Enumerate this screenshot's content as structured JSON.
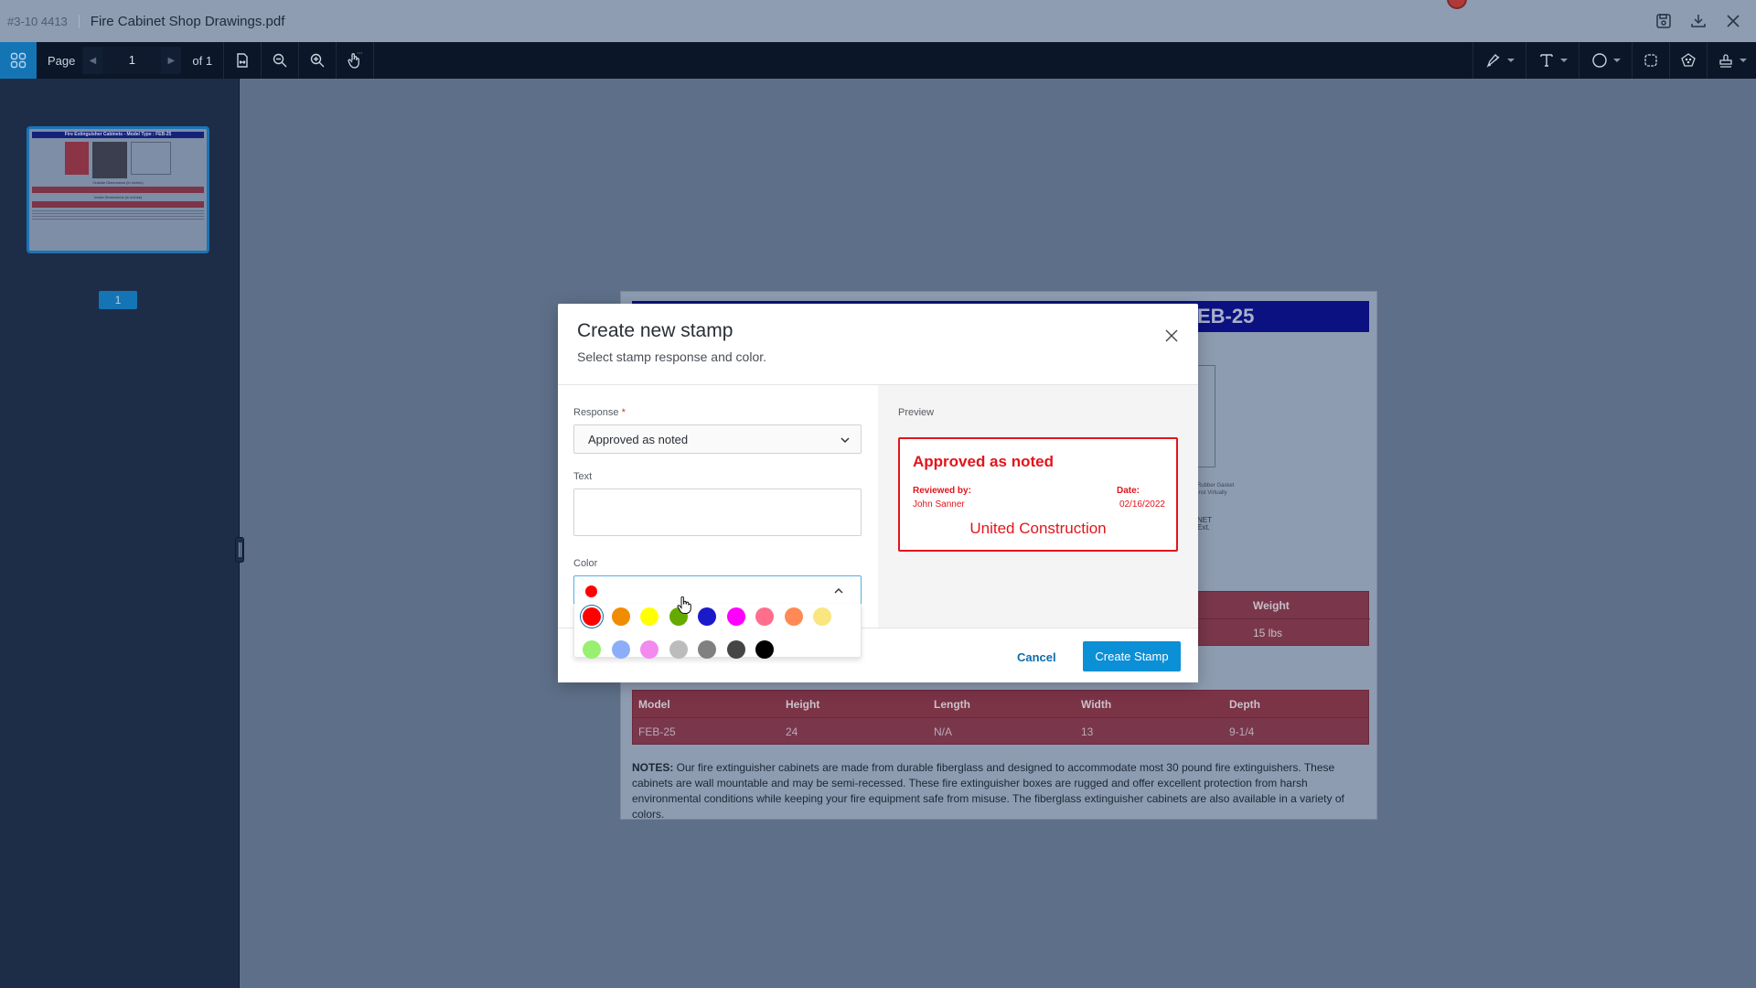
{
  "titlebar": {
    "doc_id": "#3-10 4413",
    "doc_name": "Fire Cabinet Shop Drawings.pdf",
    "icons": [
      "save-icon",
      "download-icon",
      "close-icon"
    ]
  },
  "toolbar": {
    "page_label": "Page",
    "page_value": "1",
    "page_of": "of 1",
    "left_tools": [
      "fit-width-icon",
      "zoom-out-icon",
      "zoom-in-icon",
      "pan-hand-icon"
    ],
    "right_tools": [
      "pen-icon",
      "text-icon",
      "ellipse-icon",
      "cloud-icon",
      "polygon-icon",
      "stamp-icon"
    ]
  },
  "sidebar": {
    "thumbnail_title": "Fire Extinguisher Cabinets - Model Type : FEB-25",
    "thumbnail_sub1": "Outside Dimensions (in inches)",
    "thumbnail_sub2": "Inside Dimensions (in inches)",
    "page_badge": "1"
  },
  "document": {
    "title_fragment": "EB-25",
    "drawing_label1": "Rubber Gasket\nInst Virtually",
    "drawing_label2": "NET\nExt.",
    "outside_table": {
      "visible_header": "Weight",
      "visible_value": "15 lbs"
    },
    "inside_table": {
      "headers": [
        "Model",
        "Height",
        "Length",
        "Width",
        "Depth"
      ],
      "row": [
        "FEB-25",
        "24",
        "N/A",
        "13",
        "9-1/4"
      ]
    },
    "notes_label": "NOTES:",
    "notes_text": " Our fire extinguisher cabinets are made from durable fiberglass and designed to accommodate most 30 pound fire extinguishers. These cabinets are wall mountable and may be semi-recessed. These fire extinguisher boxes are rugged and offer excellent protection from harsh environmental conditions while keeping your fire equipment safe from misuse. The fiberglass extinguisher cabinets are also available in a variety of colors."
  },
  "dialog": {
    "title": "Create new stamp",
    "subtitle": "Select stamp response and color.",
    "response_label": "Response",
    "response_required": "*",
    "response_value": "Approved as noted",
    "text_label": "Text",
    "text_value": "",
    "color_label": "Color",
    "color_selected": "#ff0000",
    "palette": [
      [
        "#ff0000",
        "#f08c00",
        "#ffff00",
        "#66aa00",
        "#1a1ac8",
        "#ff00ff",
        "#ff6e8c",
        "#ff8a55",
        "#f9e680"
      ],
      [
        "#99f070",
        "#8caef8",
        "#f28af0",
        "#bcbcbc",
        "#808080",
        "#454545",
        "#000000"
      ]
    ],
    "preview_label": "Preview",
    "stamp": {
      "title": "Approved as noted",
      "reviewed_label": "Reviewed by:",
      "reviewed_value": "John Sanner",
      "date_label": "Date:",
      "date_value": "02/16/2022",
      "company": "United Construction",
      "color": "#e3141b"
    },
    "cancel_label": "Cancel",
    "create_label": "Create Stamp"
  }
}
